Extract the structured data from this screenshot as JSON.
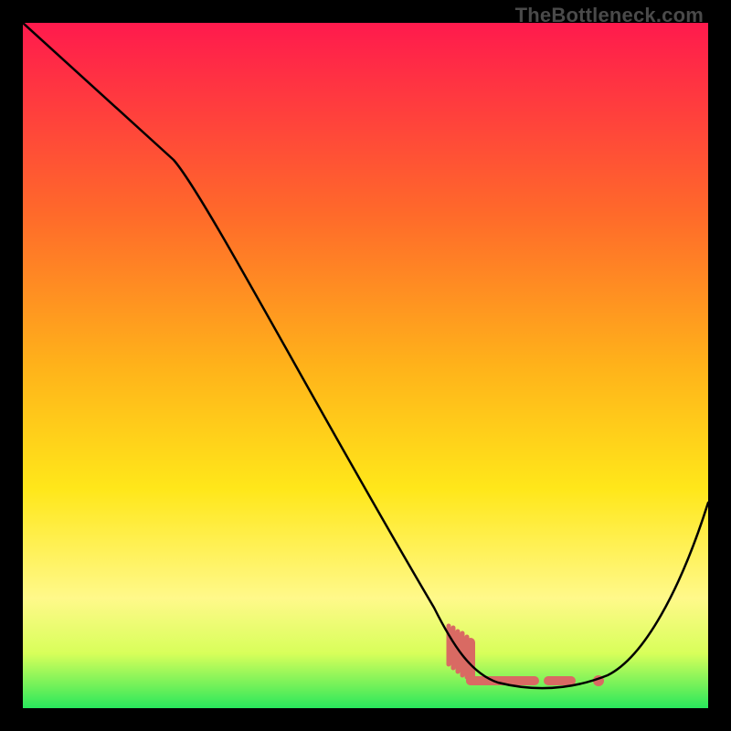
{
  "watermark": "TheBottleneck.com",
  "colors": {
    "background": "#000000",
    "curve": "#000000",
    "accent": "#d96a63",
    "gradient_stops": [
      "#ff1a4d",
      "#ff8a1f",
      "#ffe71a",
      "#fff98a",
      "#b6ff4a",
      "#28e85c"
    ]
  },
  "chart_data": {
    "type": "line",
    "title": "",
    "xlabel": "",
    "ylabel": "",
    "xlim": [
      0,
      100
    ],
    "ylim": [
      0,
      100
    ],
    "grid": false,
    "legend": false,
    "annotations": [
      "TheBottleneck.com"
    ],
    "series": [
      {
        "name": "bottleneck-curve",
        "x": [
          0,
          22,
          60,
          65,
          72,
          78,
          82,
          86,
          100
        ],
        "values": [
          100,
          80,
          13,
          5,
          1,
          0.5,
          1,
          4,
          30
        ]
      }
    ],
    "optimal_region": {
      "x_start": 62,
      "x_end": 86,
      "style": "hatched-then-flat-with-gap"
    }
  }
}
